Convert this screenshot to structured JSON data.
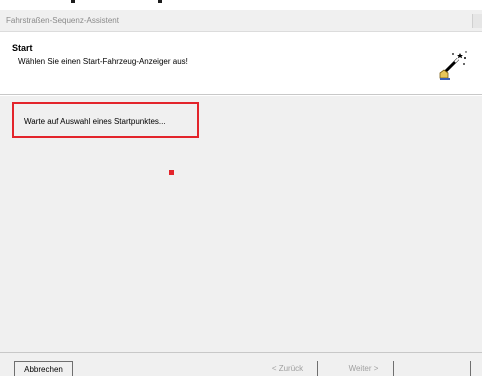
{
  "window": {
    "title": "Fahrstraßen-Sequenz-Assistent"
  },
  "header": {
    "heading": "Start",
    "subheading": "Wählen Sie einen Start-Fahrzeug-Anzeiger aus!",
    "icon": "wizard-wand-icon"
  },
  "content": {
    "status_text": "Warte auf Auswahl eines Startpunktes...",
    "highlight_color": "#e3242b"
  },
  "footer": {
    "cancel_label": "Abbrechen",
    "back_label": "< Zurück",
    "next_label": "Weiter >"
  }
}
